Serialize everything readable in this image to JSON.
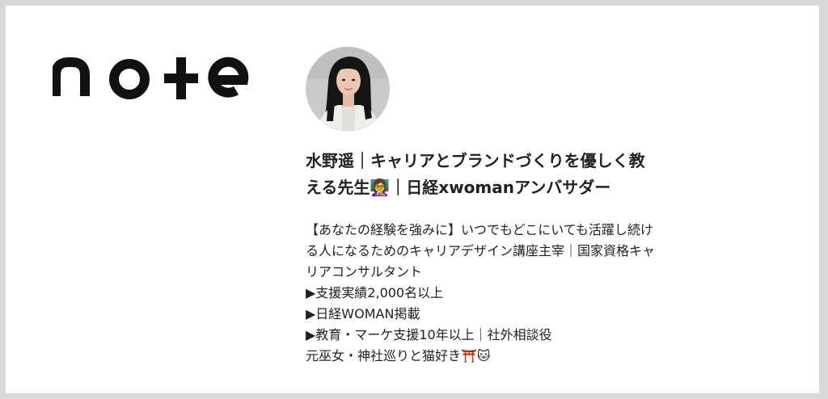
{
  "brand": {
    "logo_text": "note"
  },
  "profile": {
    "title_lines": [
      "水野遥｜キャリアとブランドづくりを優しく教",
      "える先生👩‍🏫｜日経xwomanアンバサダー"
    ],
    "bio_lines": [
      "【あなたの経験を強みに】いつでもどこにいても活躍し続け",
      "る人になるためのキャリアデザイン講座主宰｜国家資格キャ",
      "リアコンサルタント",
      "▶支援実績2,000名以上",
      "▶日経WOMAN掲載",
      "▶教育・マーケ支援10年以上｜社外相談役",
      "元巫女・神社巡りと猫好き⛩️🐱"
    ]
  },
  "colors": {
    "background": "#ffffff",
    "border": "#d8d8d8",
    "text": "#222222",
    "logo": "#111111"
  }
}
